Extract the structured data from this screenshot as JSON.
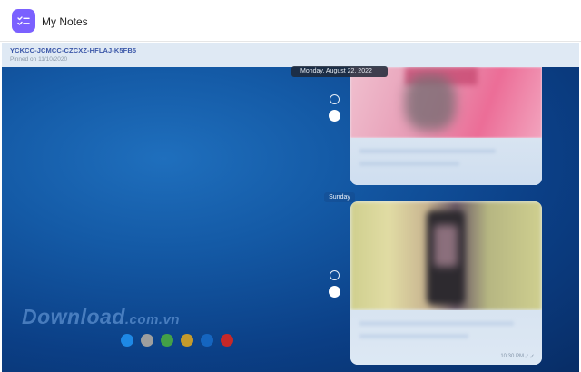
{
  "app": {
    "title": "My Notes"
  },
  "pinned": {
    "id": "YCKCC-JCMCC-CZCXZ-HFLAJ-K5FB5",
    "date": "Pinned on 11/10/2020"
  },
  "chat": {
    "date_pill": "Monday, August 22, 2022",
    "day_separator": "Sunday",
    "message_time": "10:30 PM",
    "ticks_icon": "double-check-icon"
  },
  "watermark": {
    "brand": "Download",
    "suffix": ".com.vn",
    "dot_colors": [
      "#1e88e5",
      "#9e9e9e",
      "#43a047",
      "#c49a2c",
      "#1565c0",
      "#c62828"
    ]
  },
  "colors": {
    "accent": "#7b61ff",
    "pinned_bg": "#dfe9f4",
    "bubble_bg": "#e7eef7"
  }
}
